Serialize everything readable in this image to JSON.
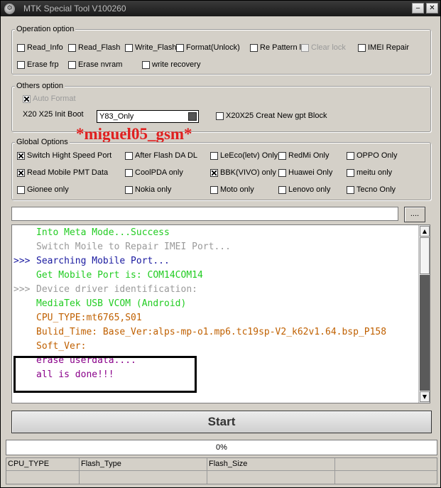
{
  "window": {
    "title": "MTK Special Tool V100260"
  },
  "operation_option": {
    "label": "Operation option",
    "items": [
      {
        "label": "Read_Info",
        "checked": false,
        "disabled": false
      },
      {
        "label": "Read_Flash",
        "checked": false,
        "disabled": false
      },
      {
        "label": "Write_Flash",
        "checked": false,
        "disabled": false
      },
      {
        "label": "Format(Unlock)",
        "checked": false,
        "disabled": false
      },
      {
        "label": "Re Pattern l",
        "checked": false,
        "disabled": false
      },
      {
        "label": "Clear lock",
        "checked": false,
        "disabled": true
      },
      {
        "label": "IMEI Repair",
        "checked": false,
        "disabled": false
      },
      {
        "label": "Erase frp",
        "checked": false,
        "disabled": false
      },
      {
        "label": "Erase nvram",
        "checked": false,
        "disabled": false
      },
      {
        "label": "write recovery",
        "checked": false,
        "disabled": false
      }
    ]
  },
  "others_option": {
    "label": "Others option",
    "auto_format": "Auto Format",
    "init_boot_label": "X20 X25 Init Boot",
    "init_boot_value": "Y83_Only",
    "gpt_block": "X20X25 Creat New gpt Block"
  },
  "watermark": "*miguel05_gsm*",
  "global_options": {
    "label": "Global Options",
    "items": [
      {
        "label": "Switch Hight Speed Port",
        "checked": true
      },
      {
        "label": "After Flash DA DL",
        "checked": false
      },
      {
        "label": "LeEco(letv) Only",
        "checked": false
      },
      {
        "label": "RedMi Only",
        "checked": false
      },
      {
        "label": "OPPO Only",
        "checked": false
      },
      {
        "label": "Read Mobile PMT Data",
        "checked": true
      },
      {
        "label": "CoolPDA only",
        "checked": false
      },
      {
        "label": "BBK(VIVO) only",
        "checked": true
      },
      {
        "label": "Huawei Only",
        "checked": false
      },
      {
        "label": "meitu only",
        "checked": false
      },
      {
        "label": "Gionee only",
        "checked": false
      },
      {
        "label": "Nokia only",
        "checked": false
      },
      {
        "label": "Moto only",
        "checked": false
      },
      {
        "label": "Lenovo only",
        "checked": false
      },
      {
        "label": "Tecno Only",
        "checked": false
      }
    ]
  },
  "file_path": {
    "value": "",
    "browse_label": "...."
  },
  "log": {
    "lines": [
      {
        "prefix": "",
        "text": "Into Meta Mode...Success",
        "color": "#22cc22"
      },
      {
        "prefix": "",
        "text": "Switch Moile to Repair IMEI Port...",
        "color": "#9a9a9a"
      },
      {
        "prefix": ">>>",
        "text": "Searching Mobile Port...",
        "color": "#1a1aa0"
      },
      {
        "prefix": "",
        "text": "Get Mobile Port is: COM14COM14",
        "color": "#22cc22"
      },
      {
        "prefix": ">>>",
        "text": "Device driver identification:",
        "color": "#9a9a9a"
      },
      {
        "prefix": "",
        "text": "MediaTek USB VCOM (Android)",
        "color": "#22cc22"
      },
      {
        "prefix": "",
        "text": "CPU_TYPE:mt6765,S01",
        "color": "#c06000"
      },
      {
        "prefix": "",
        "text": "Bulid_Time:    Base_Ver:alps-mp-o1.mp6.tc19sp-V2_k62v1.64.bsp_P158",
        "color": "#c06000"
      },
      {
        "prefix": "",
        "text": "Soft_Ver:",
        "color": "#c06000"
      },
      {
        "prefix": "",
        "text": "erase userdata....",
        "color": "#8a008a"
      },
      {
        "prefix": "",
        "text": "all is done!!!",
        "color": "#8a008a"
      }
    ]
  },
  "start_label": "Start",
  "progress": {
    "text": "0%",
    "value": 0
  },
  "status_table": {
    "columns": [
      "CPU_TYPE",
      "Flash_Type",
      "Flash_Size",
      "",
      ""
    ]
  }
}
